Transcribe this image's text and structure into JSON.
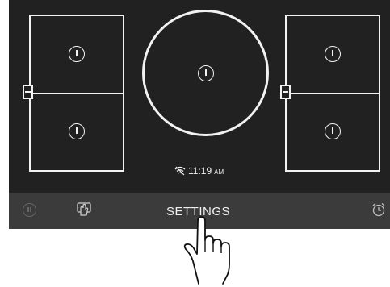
{
  "cooktop": {
    "clock": {
      "time": "11:19",
      "ampm": "AM"
    },
    "bottom_bar": {
      "settings_label": "SETTINGS"
    },
    "icons": {
      "wifi": "wifi-off-icon",
      "pause": "pause-icon",
      "lock": "hand-lock-icon",
      "timer": "alarm-clock-icon",
      "hand": "hand-pointer-icon"
    },
    "colors": {
      "panel": "#212121",
      "bottom_bar": "#3b3b3b",
      "line": "#f2f2f2"
    }
  }
}
